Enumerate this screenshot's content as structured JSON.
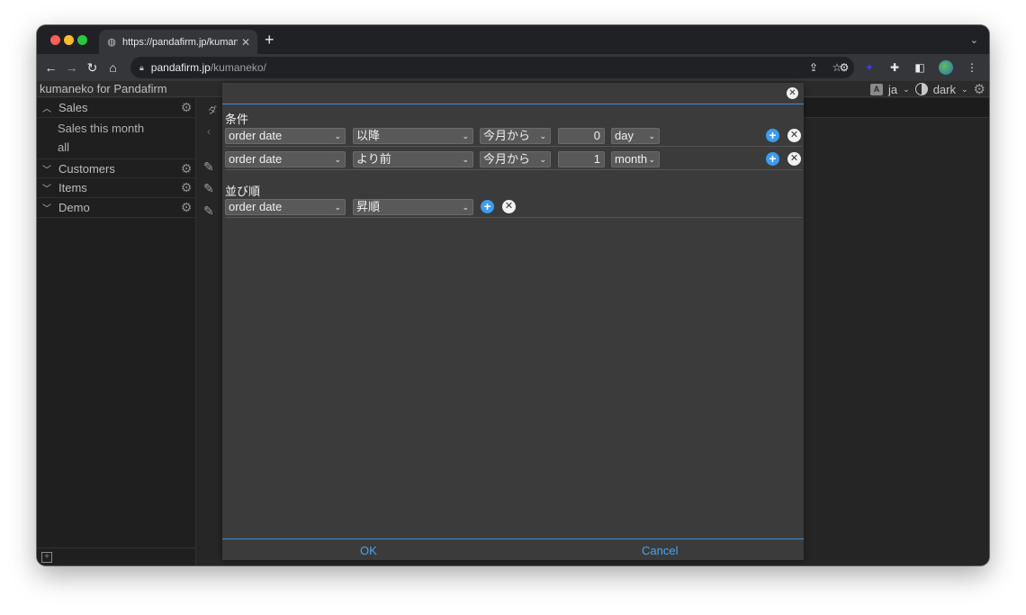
{
  "browser": {
    "tab_title": "https://pandafirm.jp/kumaneko/",
    "url_host": "pandafirm.jp",
    "url_path": "/kumaneko/"
  },
  "app": {
    "title": "kumaneko for Pandafirm",
    "language": "ja",
    "theme": "dark",
    "tab_peek": "ダ"
  },
  "sidebar": {
    "groups": [
      {
        "label": "Sales",
        "expanded": true,
        "children": [
          "Sales this month",
          "all"
        ]
      },
      {
        "label": "Customers",
        "expanded": false
      },
      {
        "label": "Items",
        "expanded": false
      },
      {
        "label": "Demo",
        "expanded": false
      }
    ]
  },
  "dialog": {
    "conditions_title": "条件",
    "conditions": [
      {
        "field": "order date",
        "operator": "以降",
        "base": "今月から",
        "value": "0",
        "unit": "day"
      },
      {
        "field": "order date",
        "operator": "より前",
        "base": "今月から",
        "value": "1",
        "unit": "month"
      }
    ],
    "sort_title": "並び順",
    "sort": [
      {
        "field": "order date",
        "order": "昇順"
      }
    ],
    "ok_label": "OK",
    "cancel_label": "Cancel"
  },
  "colors": {
    "accent": "#3d9bef",
    "dialog_bg": "#3b3b3b",
    "footer_link": "#4aa3f0"
  }
}
